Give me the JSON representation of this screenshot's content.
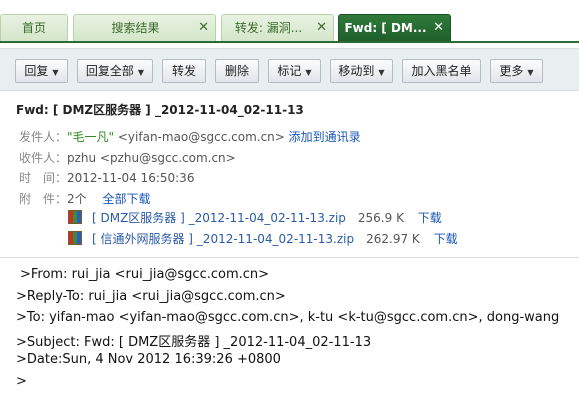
{
  "tabs": [
    {
      "label": "首页",
      "closable": false,
      "active": false
    },
    {
      "label": "搜索结果",
      "closable": true,
      "active": false
    },
    {
      "label": "转发: 漏洞...",
      "closable": true,
      "active": false
    },
    {
      "label": "Fwd: [ DM...",
      "closable": true,
      "active": true
    }
  ],
  "toolbar": {
    "reply": "回复",
    "reply_all": "回复全部",
    "forward": "转发",
    "delete": "删除",
    "mark": "标记",
    "move_to": "移动到",
    "blacklist": "加入黑名单",
    "more": "更多"
  },
  "email": {
    "subject": "Fwd: [ DMZ区服务器 ] _2012-11-04_02-11-13",
    "from_label": "发件人：",
    "from_name": "\"毛一凡\"",
    "from_addr": "<yifan-mao@sgcc.com.cn>",
    "add_contact": "添加到通讯录",
    "to_label": "收件人：",
    "to_value": "pzhu <pzhu@sgcc.com.cn>",
    "time_label": "时　间：",
    "time_value": "2012-11-04 16:50:36",
    "attach_label": "附　件：",
    "attach_count": "2个",
    "download_all": "全部下载",
    "attachments": [
      {
        "name": "[ DMZ区服务器 ] _2012-11-04_02-11-13.zip",
        "size": "256.9 K",
        "action": "下载"
      },
      {
        "name": "[ 信通外网服务器 ] _2012-11-04_02-11-13.zip",
        "size": "262.97 K",
        "action": "下载"
      }
    ]
  },
  "body_lines": [
    ">From: rui_jia <rui_jia@sgcc.com.cn>",
    ">Reply-To: rui_jia <rui_jia@sgcc.com.cn>",
    ">To: yifan-mao <yifan-mao@sgcc.com.cn>, k-tu <k-tu@sgcc.com.cn>, dong-wang",
    ">Subject: Fwd: [ DMZ区服务器 ] _2012-11-04_02-11-13",
    ">Date:Sun, 4 Nov 2012 16:39:26 +0800",
    ">"
  ]
}
